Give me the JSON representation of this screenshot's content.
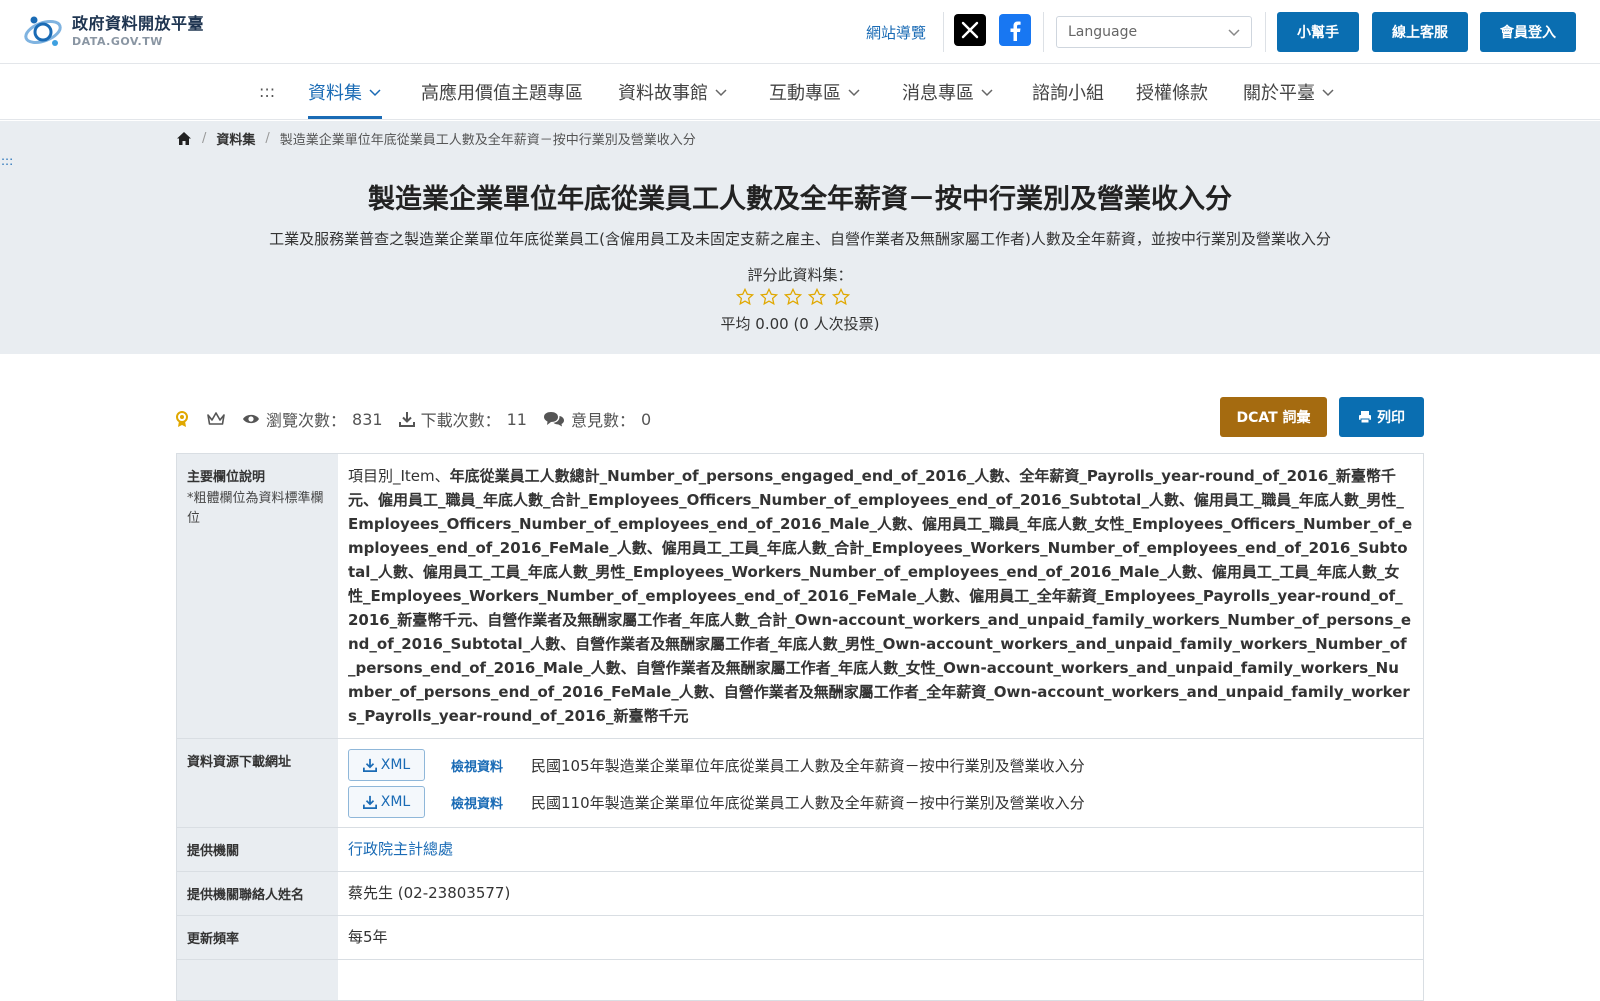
{
  "header": {
    "logo_title": "政府資料開放平臺",
    "logo_sub": "DATA.GOV.TW",
    "sitemap": "網站導覽",
    "language_placeholder": "Language",
    "help_button": "小幫手",
    "service_button": "線上客服",
    "login_button": "會員登入"
  },
  "nav": {
    "accesskey": ":::",
    "items": [
      {
        "label": "資料集"
      },
      {
        "label": "高應用價值主題專區"
      },
      {
        "label": "資料故事館"
      },
      {
        "label": "互動專區"
      },
      {
        "label": "消息專區"
      },
      {
        "label": "諮詢小組"
      },
      {
        "label": "授權條款"
      },
      {
        "label": "關於平臺"
      }
    ]
  },
  "breadcrumb": {
    "section": "資料集",
    "current": "製造業企業單位年底從業員工人數及全年薪資－按中行業別及營業收入分"
  },
  "accesskey_center": ":::",
  "dataset": {
    "title": "製造業企業單位年底從業員工人數及全年薪資－按中行業別及營業收入分",
    "description": "工業及服務業普查之製造業企業單位年底從業員工(含僱用員工及未固定支薪之雇主、自營作業者及無酬家屬工作者)人數及全年薪資，並按中行業別及營業收入分",
    "rate_label": "評分此資料集：",
    "rate_avg": "平均 0.00 (0 人次投票)"
  },
  "stats": {
    "views_label": "瀏覽次數：",
    "views": "831",
    "downloads_label": "下載次數：",
    "downloads": "11",
    "comments_label": "意見數：",
    "comments": "0"
  },
  "actions": {
    "dcat": "DCAT 詞彙",
    "print": "列印"
  },
  "table": {
    "fields_label": "主要欄位說明",
    "fields_note": "*粗體欄位為資料標準欄位",
    "fields_plain": "項目別_Item、",
    "fields_bold": "年底從業員工人數總計_Number_of_persons_engaged_end_of_2016_人數、全年薪資_Payrolls_year-round_of_2016_新臺幣千元、僱用員工_職員_年底人數_合計_Employees_Officers_Number_of_employees_end_of_2016_Subtotal_人數、僱用員工_職員_年底人數_男性_Employees_Officers_Number_of_employees_end_of_2016_Male_人數、僱用員工_職員_年底人數_女性_Employees_Officers_Number_of_employees_end_of_2016_FeMale_人數、僱用員工_工員_年底人數_合計_Employees_Workers_Number_of_employees_end_of_2016_Subtotal_人數、僱用員工_工員_年底人數_男性_Employees_Workers_Number_of_employees_end_of_2016_Male_人數、僱用員工_工員_年底人數_女性_Employees_Workers_Number_of_employees_end_of_2016_FeMale_人數、僱用員工_全年薪資_Employees_Payrolls_year-round_of_2016_新臺幣千元、自營作業者及無酬家屬工作者_年底人數_合計_Own-account_workers_and_unpaid_family_workers_Number_of_persons_end_of_2016_Subtotal_人數、自營作業者及無酬家屬工作者_年底人數_男性_Own-account_workers_and_unpaid_family_workers_Number_of_persons_end_of_2016_Male_人數、自營作業者及無酬家屬工作者_年底人數_女性_Own-account_workers_and_unpaid_family_workers_Number_of_persons_end_of_2016_FeMale_人數、自營作業者及無酬家屬工作者_全年薪資_Own-account_workers_and_unpaid_family_workers_Payrolls_year-round_of_2016_新臺幣千元",
    "resources_label": "資料資源下載網址",
    "resources": [
      {
        "format": "XML",
        "view": "檢視資料",
        "name": "民國105年製造業企業單位年底從業員工人數及全年薪資－按中行業別及營業收入分"
      },
      {
        "format": "XML",
        "view": "檢視資料",
        "name": "民國110年製造業企業單位年底從業員工人數及全年薪資－按中行業別及營業收入分"
      }
    ],
    "provider_label": "提供機關",
    "provider": "行政院主計總處",
    "contact_label": "提供機關聯絡人姓名",
    "contact": "蔡先生 (02-23803577)",
    "frequency_label": "更新頻率",
    "frequency": "每5年"
  },
  "colors": {
    "primary": "#0a6eb1",
    "dcat": "#a56b10",
    "hero_bg": "#e9edf1",
    "star": "#e0a800"
  }
}
